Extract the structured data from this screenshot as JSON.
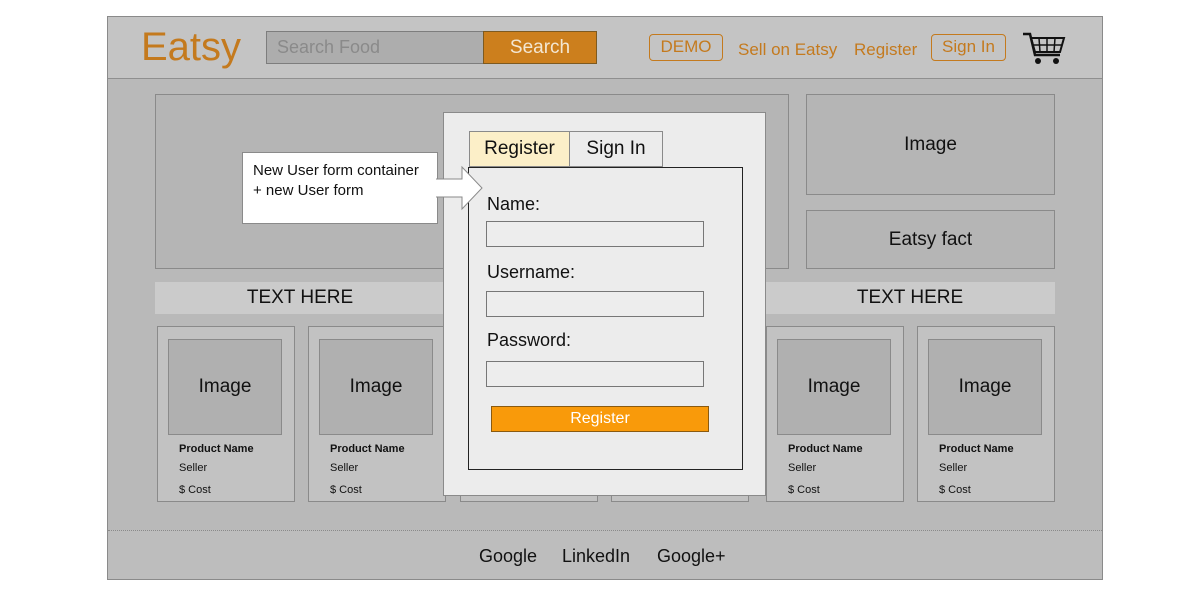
{
  "header": {
    "logo": "Eatsy",
    "search_placeholder": "Search Food",
    "search_button": "Search",
    "demo": "DEMO",
    "sell": "Sell on Eatsy",
    "register": "Register",
    "sign_in": "Sign In",
    "cart_icon": "shopping-cart-icon"
  },
  "hero": {
    "side_image": "Image",
    "eatsy_fact": "Eatsy fact"
  },
  "strips": {
    "left": "TEXT HERE",
    "right": "TEXT HERE"
  },
  "cards": [
    {
      "image": "Image",
      "name": "Product Name",
      "seller": "Seller",
      "cost": "$ Cost"
    },
    {
      "image": "Image",
      "name": "Product Name",
      "seller": "Seller",
      "cost": "$ Cost"
    },
    {
      "image": "Image",
      "name": "Product Name",
      "seller": "Seller",
      "cost": "$ Cost"
    },
    {
      "image": "Image",
      "name": "Product Name",
      "seller": "Seller",
      "cost": "$ Cost"
    }
  ],
  "footer": {
    "google": "Google",
    "linkedin": "LinkedIn",
    "googleplus": "Google+"
  },
  "modal": {
    "tab_register": "Register",
    "tab_signin": "Sign In",
    "name_label": "Name:",
    "username_label": "Username:",
    "password_label": "Password:",
    "submit": "Register"
  },
  "callout": {
    "text": "New User form container + new User form"
  },
  "colors": {
    "brand_orange": "#c47a1e",
    "submit_orange": "#f99a0a",
    "active_tab": "#fcefc8"
  }
}
